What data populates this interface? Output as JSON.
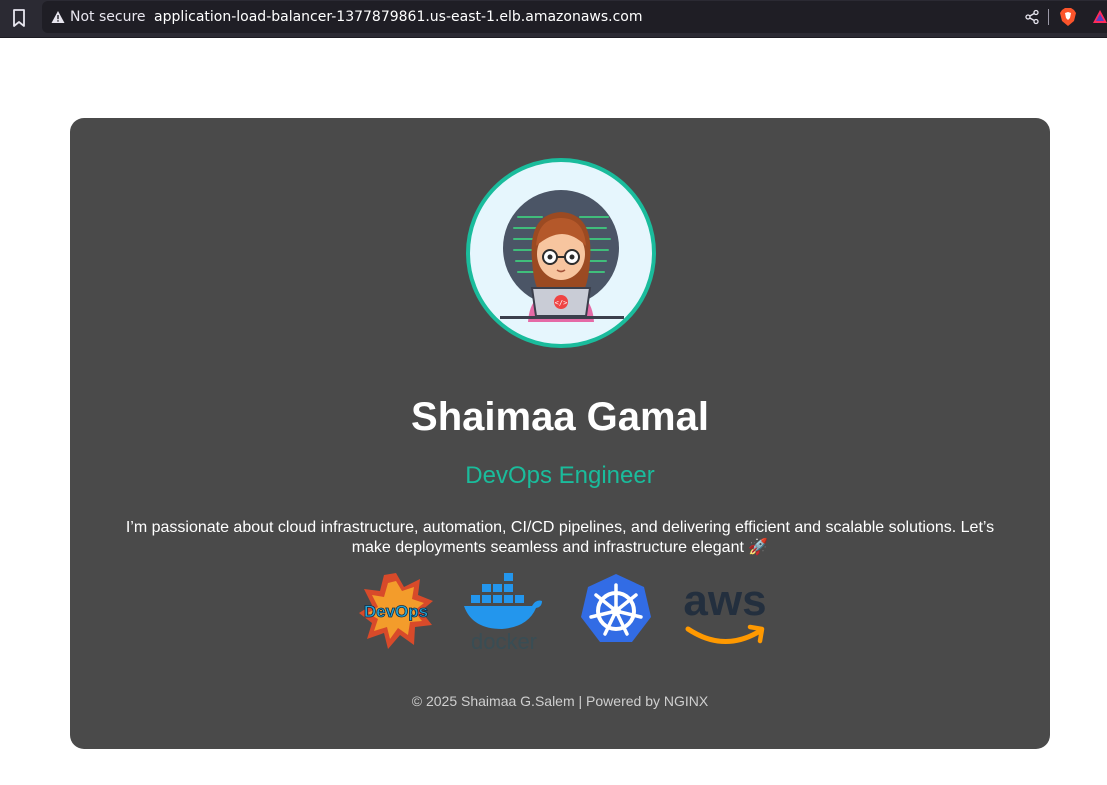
{
  "browser": {
    "security_label": "Not secure",
    "url": "application-load-balancer-1377879861.us-east-1.elb.amazonaws.com"
  },
  "profile": {
    "name": "Shaimaa Gamal",
    "role": "DevOps Engineer",
    "bio": "I’m passionate about cloud infrastructure, automation, CI/CD pipelines, and delivering efficient and scalable solutions. Let’s make deployments seamless and infrastructure elegant 🚀",
    "avatar": "girl-coding-on-laptop-illustration"
  },
  "logos": [
    {
      "name": "devops-logo",
      "text": "DevOps"
    },
    {
      "name": "docker-logo",
      "text": "docker"
    },
    {
      "name": "kubernetes-logo"
    },
    {
      "name": "aws-logo",
      "text": "aws"
    }
  ],
  "footer": {
    "text": "© 2025 Shaimaa G.Salem | Powered by NGINX"
  },
  "colors": {
    "accent": "#1abc9c",
    "card": "#4a4a4a",
    "browser_bar": "#2b2a33"
  }
}
